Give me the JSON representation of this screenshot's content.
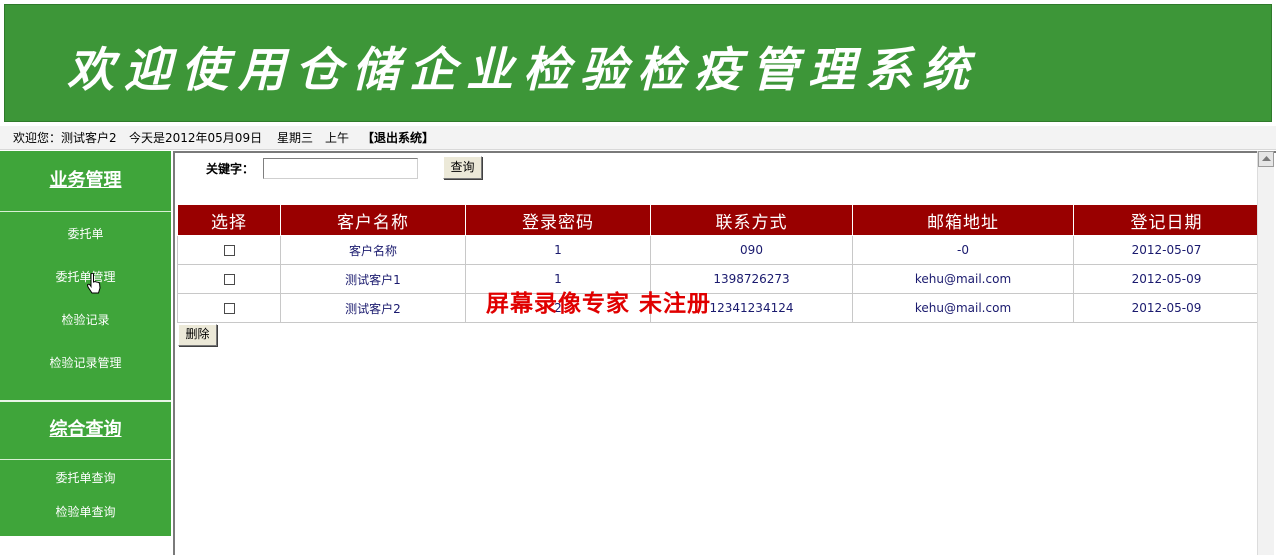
{
  "banner": {
    "title": "欢迎使用仓储企业检验检疫管理系统"
  },
  "status": {
    "welcome": "欢迎您：测试客户2",
    "today": "今天是2012年05月09日",
    "weekday": "星期三",
    "period": "上午",
    "logout": "【退出系统】"
  },
  "sidebar": {
    "section1": {
      "title": "业务管理",
      "items": [
        "委托单",
        "委托单管理",
        "检验记录",
        "检验记录管理"
      ]
    },
    "section2": {
      "title": "综合查询",
      "items": [
        "委托单查询",
        "检验单查询"
      ]
    }
  },
  "search": {
    "label": "关键字：",
    "value": "",
    "button": "查询"
  },
  "table": {
    "headers": [
      "选择",
      "客户名称",
      "登录密码",
      "联系方式",
      "邮箱地址",
      "登记日期"
    ],
    "rows": [
      [
        "",
        "客户名称",
        "1",
        "090",
        "-0",
        "2012-05-07"
      ],
      [
        "",
        "测试客户1",
        "1",
        "1398726273",
        "kehu@mail.com",
        "2012-05-09"
      ],
      [
        "",
        "测试客户2",
        "2",
        "12341234124",
        "kehu@mail.com",
        "2012-05-09"
      ]
    ]
  },
  "actions": {
    "delete": "删除"
  },
  "watermark": "屏幕录像专家  未注册",
  "colors": {
    "banner_bg": "#3d9638",
    "sidebar_bg": "#3fa53a",
    "header_bg": "#990000",
    "watermark": "#e00000"
  }
}
